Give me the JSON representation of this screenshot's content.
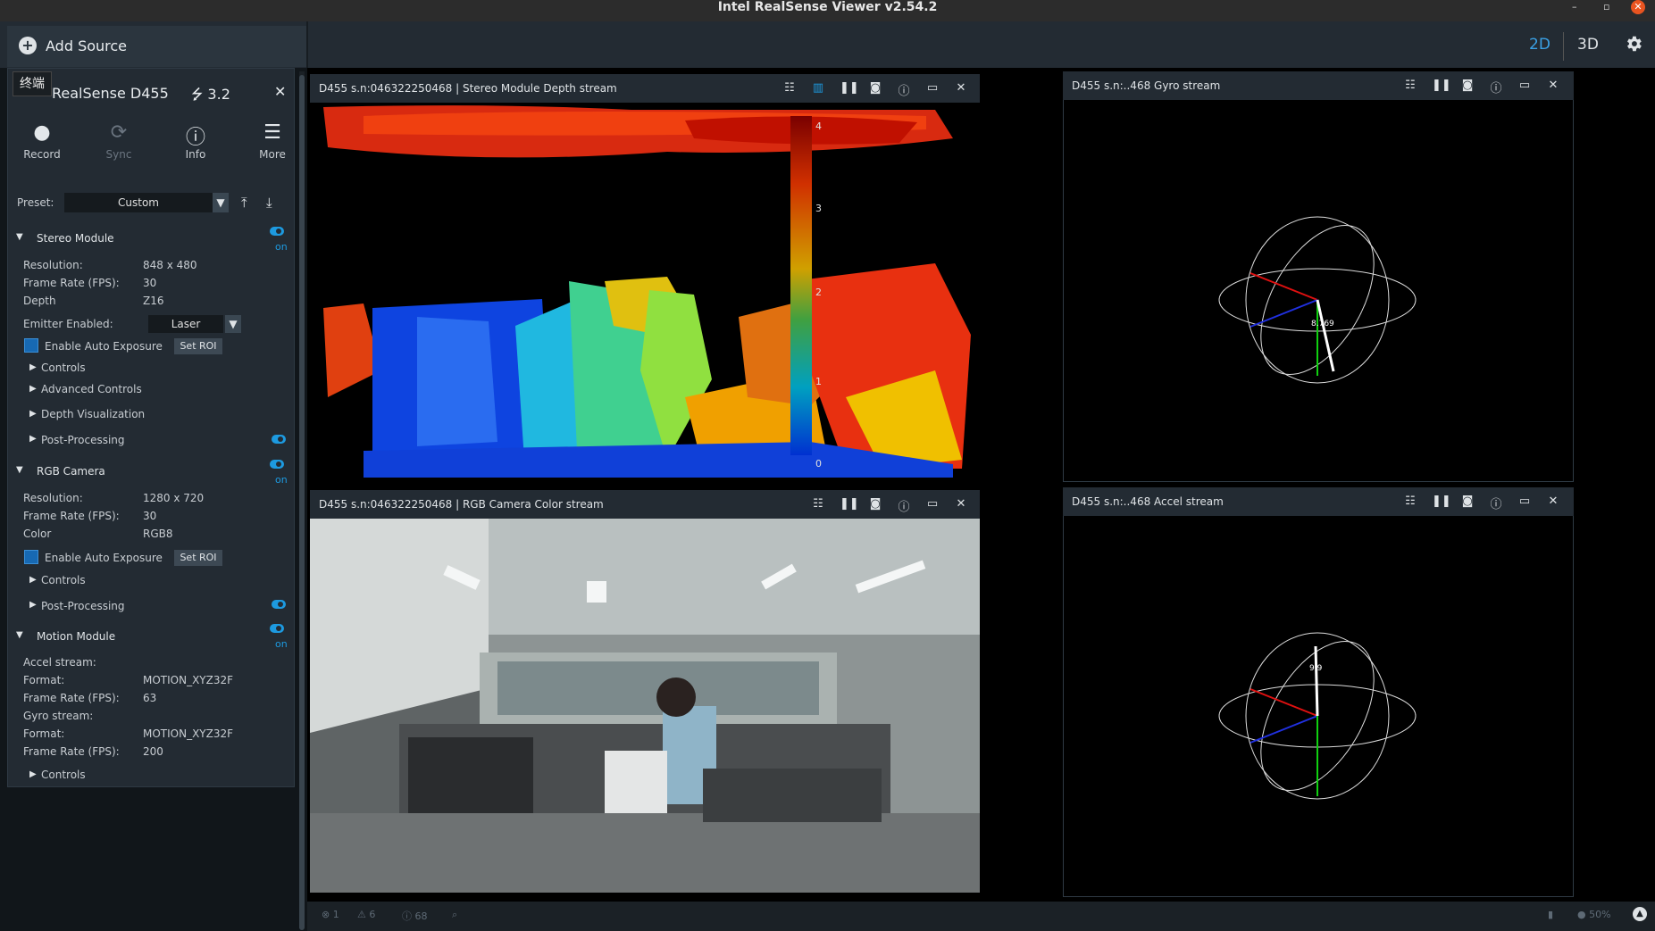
{
  "window": {
    "title": "Intel RealSense Viewer v2.54.2",
    "minimize": "–",
    "maximize": "▫",
    "close": "✕"
  },
  "topbar": {
    "add_source": "Add Source",
    "view_2d": "2D",
    "view_3d": "3D",
    "accent_color": "#3aa1e6"
  },
  "overlay_tag": "终端",
  "device": {
    "name": "RealSense D455",
    "usb": "3.2",
    "close": "✕",
    "toolbar": [
      {
        "label": "Record",
        "icon": "record-icon"
      },
      {
        "label": "Sync",
        "icon": "sync-icon"
      },
      {
        "label": "Info",
        "icon": "info-icon"
      },
      {
        "label": "More",
        "icon": "menu-icon"
      }
    ],
    "preset_label": "Preset:",
    "preset_value": "Custom"
  },
  "stereo": {
    "title": "Stereo Module",
    "on": "on",
    "rows": [
      {
        "k": "Resolution:",
        "v": "848 x 480"
      },
      {
        "k": "Frame Rate (FPS):",
        "v": "30"
      },
      {
        "k": "Depth",
        "v": "Z16"
      }
    ],
    "emitter_label": "Emitter Enabled:",
    "emitter_value": "Laser",
    "auto_exposure": "Enable Auto Exposure",
    "set_roi": "Set ROI",
    "controls": "Controls",
    "advanced": "Advanced Controls",
    "depth_vis": "Depth Visualization",
    "post": "Post-Processing"
  },
  "rgb": {
    "title": "RGB Camera",
    "on": "on",
    "rows": [
      {
        "k": "Resolution:",
        "v": "1280 x 720"
      },
      {
        "k": "Frame Rate (FPS):",
        "v": "30"
      },
      {
        "k": "Color",
        "v": "RGB8"
      }
    ],
    "auto_exposure": "Enable Auto Exposure",
    "set_roi": "Set ROI",
    "controls": "Controls",
    "post": "Post-Processing"
  },
  "motion": {
    "title": "Motion Module",
    "on": "on",
    "rows": [
      {
        "k": "Accel stream:",
        "v": ""
      },
      {
        "k": "Format:",
        "v": "MOTION_XYZ32F"
      },
      {
        "k": "Frame Rate (FPS):",
        "v": "63"
      },
      {
        "k": "Gyro stream:",
        "v": ""
      },
      {
        "k": "Format:",
        "v": "MOTION_XYZ32F"
      },
      {
        "k": "Frame Rate (FPS):",
        "v": "200"
      }
    ],
    "controls": "Controls"
  },
  "streams": {
    "depth_title": "D455 s.n:046322250468 | Stereo Module Depth stream",
    "depth_scale": [
      "4",
      "3",
      "2",
      "1",
      "0"
    ],
    "rgb_title": "D455 s.n:046322250468 | RGB Camera Color stream",
    "gyro_title": "D455 s.n:..468 Gyro stream",
    "gyro_value": "8.769",
    "accel_title": "D455 s.n:..468 Accel stream",
    "accel_value": "9.9"
  },
  "status": {
    "errors": "1",
    "warnings": "6",
    "info": "68",
    "zoom": "50%"
  }
}
